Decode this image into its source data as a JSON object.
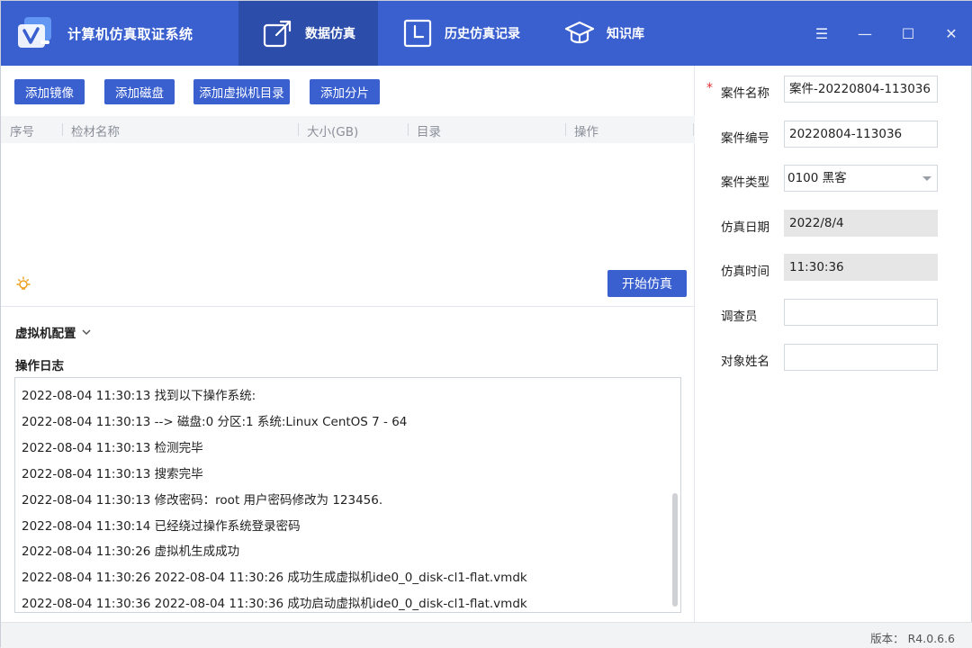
{
  "app": {
    "title": "计算机仿真取证系统"
  },
  "nav": {
    "tabs": [
      {
        "label": "数据仿真",
        "icon": "open-external-icon",
        "active": true
      },
      {
        "label": "历史仿真记录",
        "icon": "clock-icon",
        "active": false
      },
      {
        "label": "知识库",
        "icon": "graduation-cap-icon",
        "active": false
      }
    ]
  },
  "window_controls": {
    "menu": "☰",
    "minimize": "—",
    "maximize": "☐",
    "close": "✕"
  },
  "toolbar": {
    "add_image": "添加镜像",
    "add_disk": "添加磁盘",
    "add_vm_dir": "添加虚拟机目录",
    "add_shard": "添加分片"
  },
  "table": {
    "columns": [
      "序号",
      "检材名称",
      "大小(GB)",
      "目录",
      "操作"
    ],
    "rows": []
  },
  "actions": {
    "start_simulation": "开始仿真"
  },
  "vm_config": {
    "label": "虚拟机配置"
  },
  "log": {
    "title": "操作日志",
    "lines": [
      "2022-08-04 11:30:13 找到以下操作系统:",
      "2022-08-04 11:30:13 --> 磁盘:0 分区:1  系统:Linux CentOS 7 - 64",
      "2022-08-04 11:30:13 检测完毕",
      "2022-08-04 11:30:13 搜索完毕",
      "2022-08-04 11:30:13 修改密码：root 用户密码修改为 123456.",
      "2022-08-04 11:30:14 已经绕过操作系统登录密码",
      "2022-08-04 11:30:26 虚拟机生成成功",
      "2022-08-04 11:30:26 2022-08-04 11:30:26  成功生成虚拟机ide0_0_disk-cl1-flat.vmdk",
      "2022-08-04 11:30:36 2022-08-04 11:30:36  成功启动虚拟机ide0_0_disk-cl1-flat.vmdk"
    ]
  },
  "case": {
    "required_mark": "*",
    "name_label": "案件名称",
    "name_value": "案件-20220804-113036",
    "number_label": "案件编号",
    "number_value": "20220804-113036",
    "type_label": "案件类型",
    "type_value": "0100 黑客",
    "date_label": "仿真日期",
    "date_value": "2022/8/4",
    "time_label": "仿真时间",
    "time_value": "11:30:36",
    "investigator_label": "调查员",
    "investigator_value": "",
    "subject_label": "对象姓名",
    "subject_value": ""
  },
  "status": {
    "version": "版本：  R4.0.6.6"
  },
  "colors": {
    "primary": "#3a60cf",
    "primary_dark": "#2d4dab",
    "required": "#e03030"
  }
}
